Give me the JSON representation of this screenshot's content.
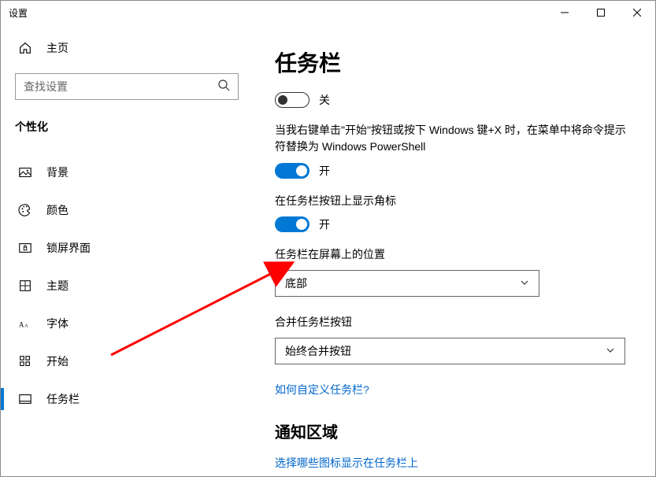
{
  "window": {
    "title": "设置"
  },
  "home": {
    "label": "主页"
  },
  "search": {
    "placeholder": "查找设置"
  },
  "category": {
    "title": "个性化"
  },
  "sidebar": {
    "items": [
      {
        "label": "背景"
      },
      {
        "label": "颜色"
      },
      {
        "label": "锁屏界面"
      },
      {
        "label": "主题"
      },
      {
        "label": "字体"
      },
      {
        "label": "开始"
      },
      {
        "label": "任务栏"
      }
    ]
  },
  "page": {
    "title": "任务栏"
  },
  "toggle1": {
    "state": "off",
    "label": "关"
  },
  "setting1": {
    "desc": "当我右键单击\"开始\"按钮或按下 Windows 键+X 时，在菜单中将命令提示符替换为 Windows PowerShell"
  },
  "toggle2": {
    "state": "on",
    "label": "开"
  },
  "setting2": {
    "label": "在任务栏按钮上显示角标"
  },
  "toggle3": {
    "state": "on",
    "label": "开"
  },
  "setting3": {
    "label": "任务栏在屏幕上的位置"
  },
  "dropdown1": {
    "value": "底部"
  },
  "setting4": {
    "label": "合并任务栏按钮"
  },
  "dropdown2": {
    "value": "始终合并按钮"
  },
  "link1": {
    "text": "如何自定义任务栏?"
  },
  "section2": {
    "title": "通知区域"
  },
  "link2": {
    "text": "选择哪些图标显示在任务栏上"
  }
}
